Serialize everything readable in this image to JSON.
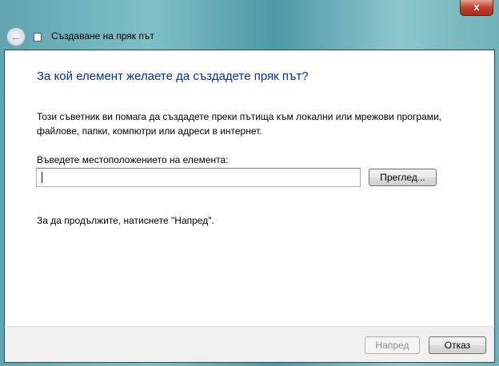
{
  "window": {
    "title": "Създаване на пряк път",
    "close_label": "x"
  },
  "main": {
    "heading": "За кой елемент желаете да създадете пряк път?",
    "description": "Този съветник ви помага да създадете преки пътища към локални или мрежови програми, файлове, папки, компютри или адреси в интернет.",
    "location_label": "Въведете местоположението на елемента:",
    "location_value": "",
    "browse_label": "Преглед...",
    "hint": "За да продължите, натиснете \"Напред\"."
  },
  "footer": {
    "next_label": "Напред",
    "cancel_label": "Отказ"
  }
}
